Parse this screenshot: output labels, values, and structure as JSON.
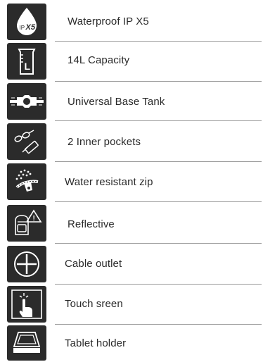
{
  "features": [
    {
      "label": "Waterproof  IP X5",
      "icon": "waterproof-ipx5-icon",
      "badge": {
        "ip": "IP",
        "x5": "X5"
      }
    },
    {
      "label": "14L Capacity",
      "icon": "capacity-jug-icon",
      "badge": "L"
    },
    {
      "label": "Universal Base Tank",
      "icon": "universal-base-tank-icon"
    },
    {
      "label": "2 Inner pockets",
      "icon": "inner-pockets-icon"
    },
    {
      "label": "Water resistant zip",
      "icon": "water-resistant-zip-icon"
    },
    {
      "label": "Reflective",
      "icon": "reflective-backpack-icon",
      "badge": "!"
    },
    {
      "label": "Cable outlet",
      "icon": "cable-outlet-icon"
    },
    {
      "label": "Touch sreen",
      "icon": "touch-screen-icon"
    },
    {
      "label": "Tablet holder",
      "icon": "tablet-holder-icon"
    }
  ],
  "colors": {
    "icon_background": "#2b2b2b",
    "icon_foreground": "#ffffff",
    "text": "#2a2a2a",
    "divider": "#9a9a9a"
  }
}
